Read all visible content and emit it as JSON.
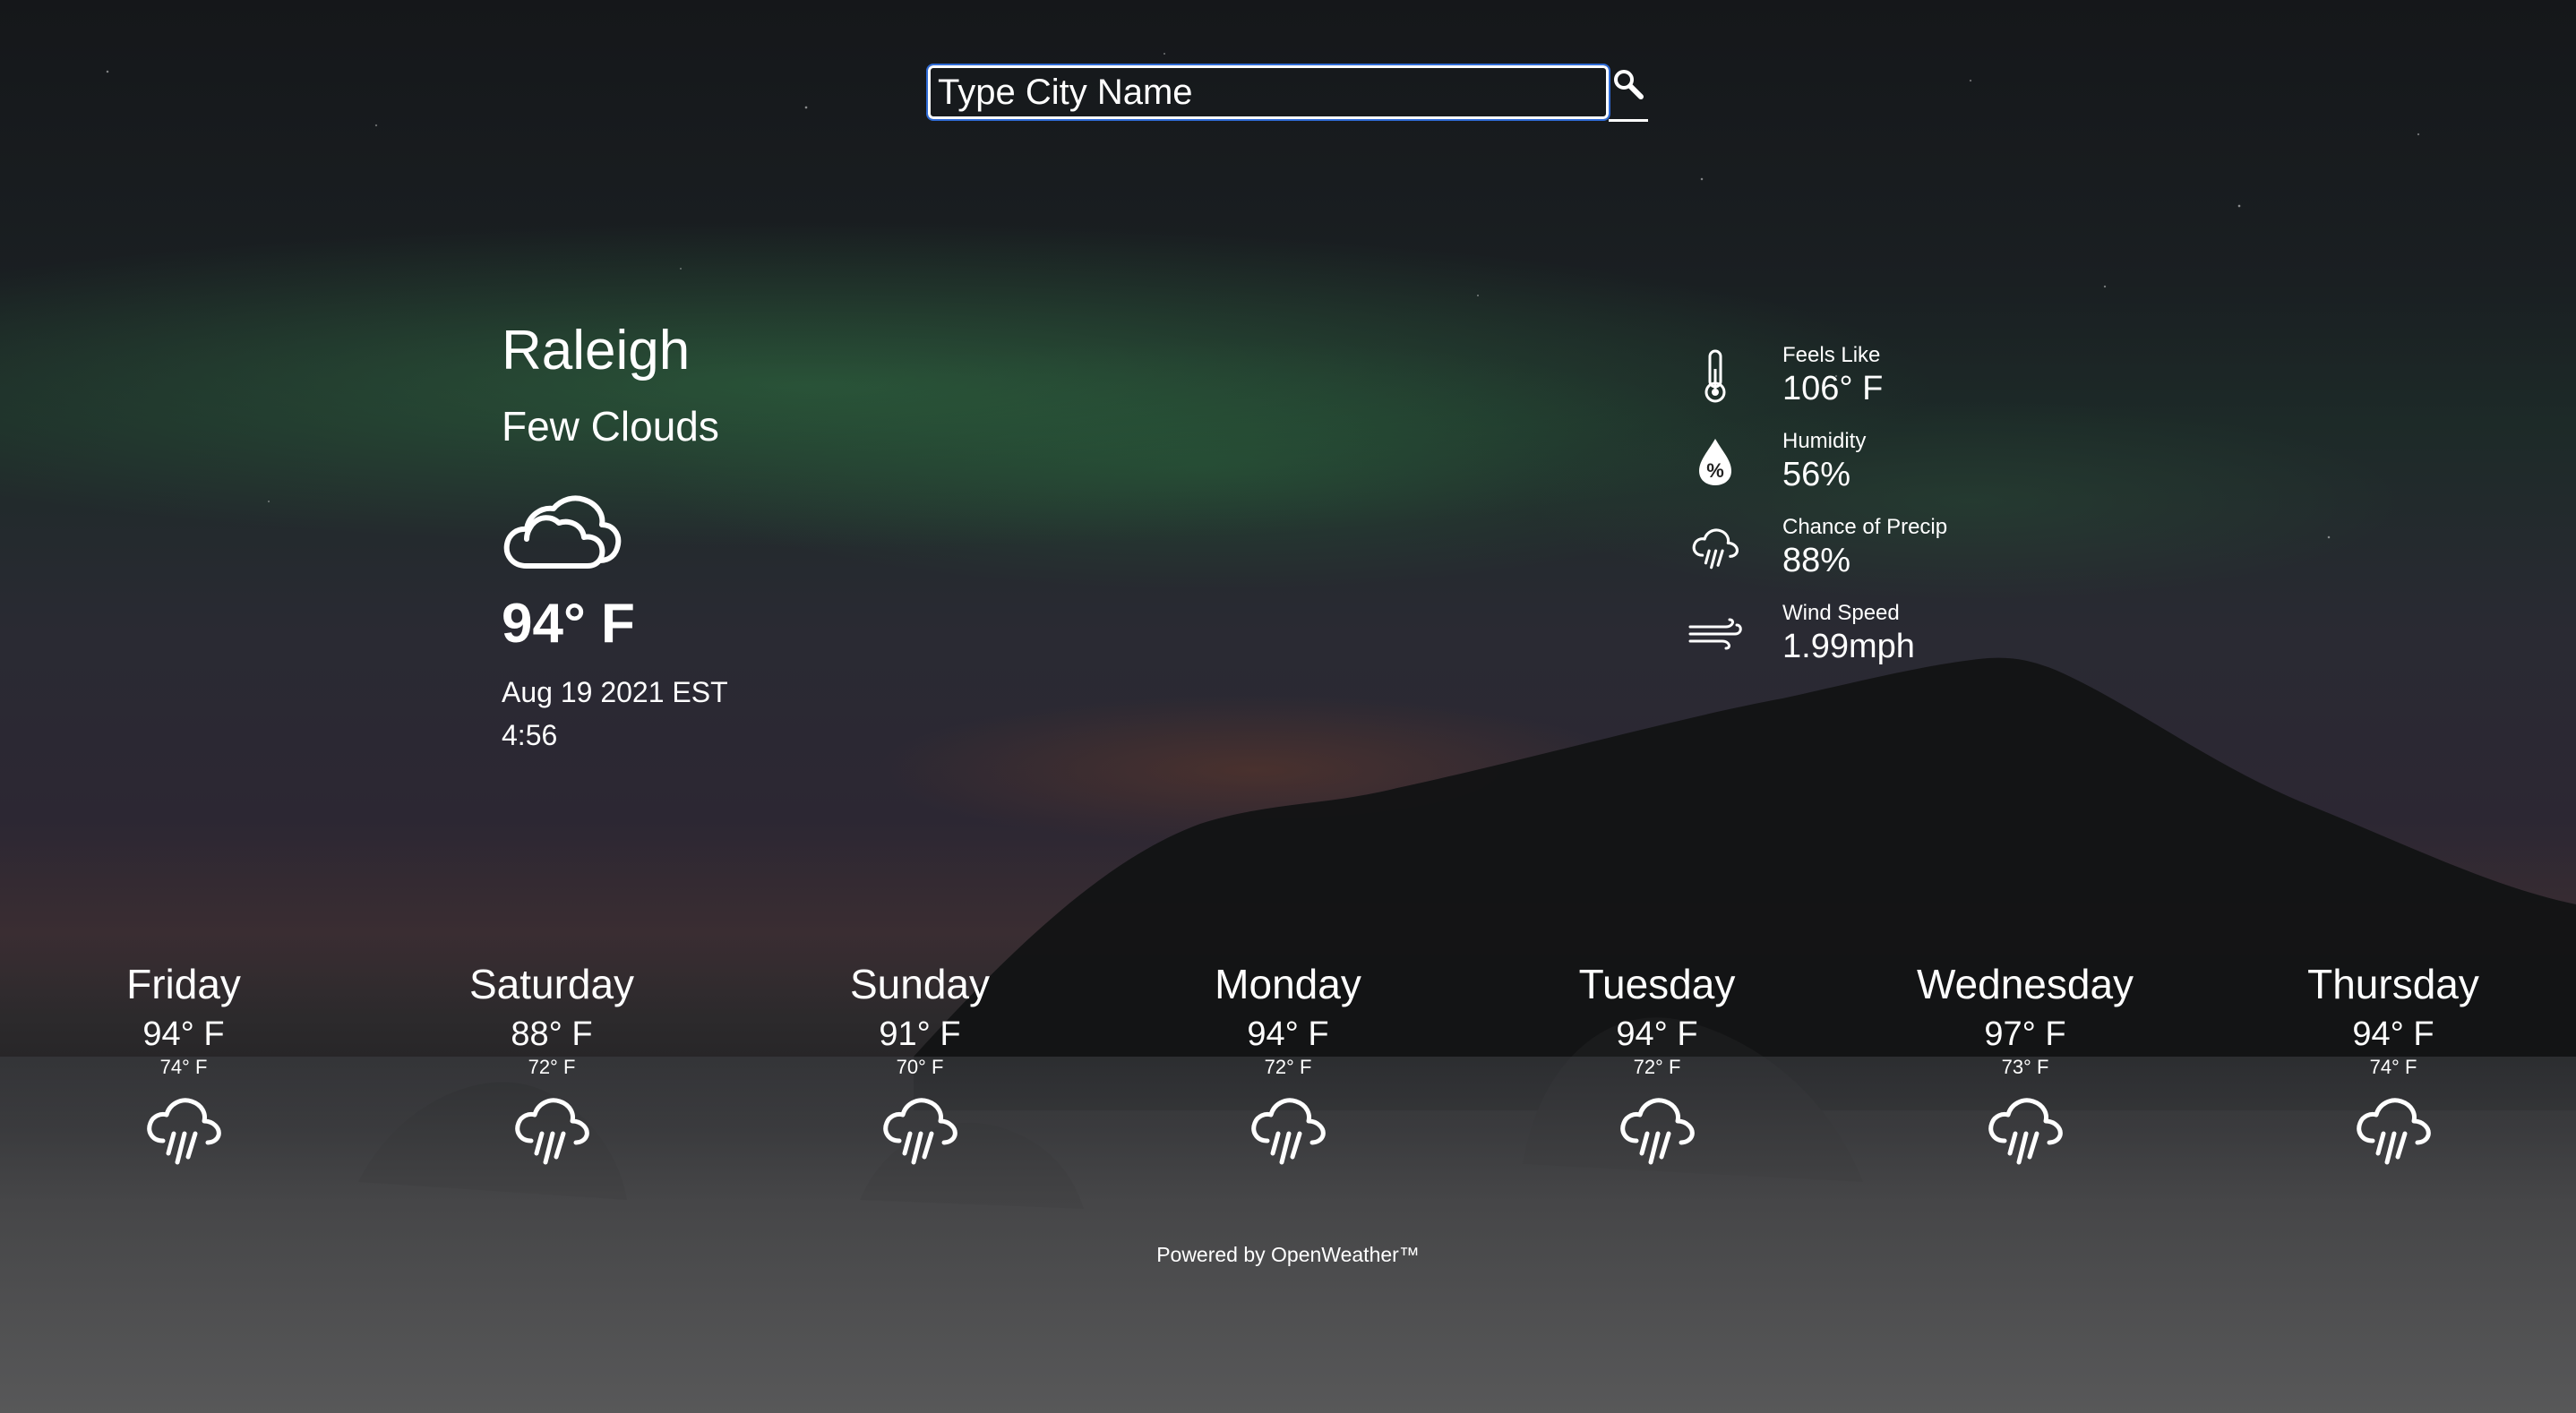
{
  "search": {
    "placeholder": "Type City Name",
    "button_icon": "search-icon"
  },
  "current": {
    "city": "Raleigh",
    "description": "Few Clouds",
    "icon": "cloud-icon",
    "temperature": "94° F",
    "date": "Aug 19 2021 EST",
    "time": "4:56"
  },
  "details": [
    {
      "icon": "thermometer-icon",
      "label": "Feels Like",
      "value": "106° F"
    },
    {
      "icon": "humidity-drop-icon",
      "label": "Humidity",
      "value": "56%"
    },
    {
      "icon": "rain-cloud-icon",
      "label": "Chance of Precip",
      "value": "88%"
    },
    {
      "icon": "wind-icon",
      "label": "Wind Speed",
      "value": "1.99mph"
    }
  ],
  "forecast": [
    {
      "day": "Friday",
      "high": "94° F",
      "low": "74° F",
      "icon": "rain-cloud-icon"
    },
    {
      "day": "Saturday",
      "high": "88° F",
      "low": "72° F",
      "icon": "rain-cloud-icon"
    },
    {
      "day": "Sunday",
      "high": "91° F",
      "low": "70° F",
      "icon": "rain-cloud-icon"
    },
    {
      "day": "Monday",
      "high": "94° F",
      "low": "72° F",
      "icon": "rain-cloud-icon"
    },
    {
      "day": "Tuesday",
      "high": "94° F",
      "low": "72° F",
      "icon": "rain-cloud-icon"
    },
    {
      "day": "Wednesday",
      "high": "97° F",
      "low": "73° F",
      "icon": "rain-cloud-icon"
    },
    {
      "day": "Thursday",
      "high": "94° F",
      "low": "74° F",
      "icon": "rain-cloud-icon"
    }
  ],
  "footer": {
    "text": "Powered by OpenWeather™"
  },
  "colors": {
    "text": "#ffffff",
    "input_focus": "#2f6bd6"
  }
}
